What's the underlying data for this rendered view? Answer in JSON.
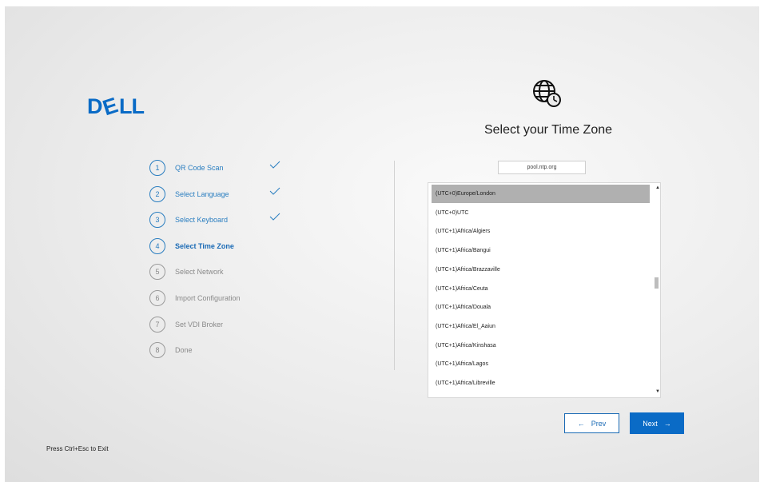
{
  "brand": {
    "logo_text": "DELL",
    "accent": "#2a7ec0",
    "button_color": "#0a6bc6"
  },
  "steps": [
    {
      "number": "1",
      "label": "QR Code Scan",
      "status": "done"
    },
    {
      "number": "2",
      "label": "Select Language",
      "status": "done"
    },
    {
      "number": "3",
      "label": "Select Keyboard",
      "status": "done"
    },
    {
      "number": "4",
      "label": "Select Time Zone",
      "status": "active"
    },
    {
      "number": "5",
      "label": "Select Network",
      "status": "pending"
    },
    {
      "number": "6",
      "label": "Import Configuration",
      "status": "pending"
    },
    {
      "number": "7",
      "label": "Set VDI Broker",
      "status": "pending"
    },
    {
      "number": "8",
      "label": "Done",
      "status": "pending"
    }
  ],
  "timezone": {
    "icon": "globe-clock-icon",
    "title": "Select your Time Zone",
    "ntp_value": "pool.ntp.org",
    "items": [
      "(UTC+0)Europe/London",
      "(UTC+0)UTC",
      "(UTC+1)Africa/Algiers",
      "(UTC+1)Africa/Bangui",
      "(UTC+1)Africa/Brazzaville",
      "(UTC+1)Africa/Ceuta",
      "(UTC+1)Africa/Douala",
      "(UTC+1)Africa/El_Aaiun",
      "(UTC+1)Africa/Kinshasa",
      "(UTC+1)Africa/Lagos",
      "(UTC+1)Africa/Libreville"
    ],
    "selected": "(UTC+0)Europe/London"
  },
  "nav": {
    "prev_label": "Prev",
    "next_label": "Next"
  },
  "footer": {
    "exit_hint": "Press Ctrl+Esc to Exit"
  }
}
